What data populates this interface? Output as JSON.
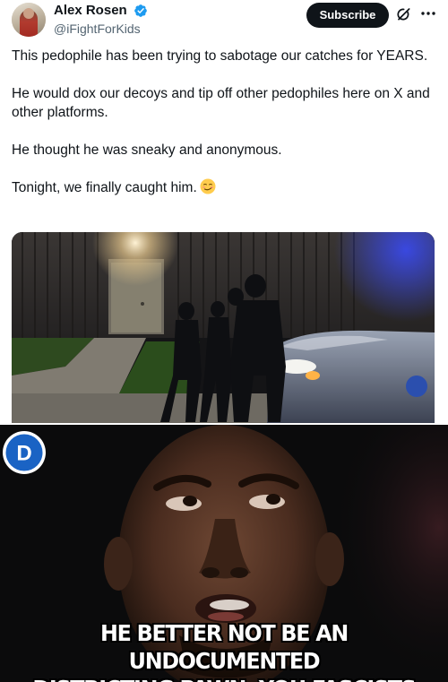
{
  "tweet": {
    "author": {
      "display_name": "Alex Rosen",
      "handle": "@iFightForKids",
      "verified": true
    },
    "subscribe_label": "Subscribe",
    "icons": {
      "verified": "verified-badge-icon",
      "grok": "grok-icon",
      "more": "more-options-icon",
      "emoji": "smirking-face-emoji"
    },
    "paragraphs": [
      "This pedophile has been trying to sabotage our catches for YEARS.",
      "He would dox our decoys and tip off other pedophiles here on X and other platforms.",
      "He thought he was sneaky and anonymous.",
      "Tonight, we finally caught him."
    ],
    "accent_color": "#1d9bf0"
  },
  "meme": {
    "logo": "democratic-party-d-logo",
    "logo_letter": "D",
    "caption_line1": "HE BETTER NOT BE AN UNDOCUMENTED",
    "caption_line2": "DISTRICTING PAWN, YOU FASCISTS"
  }
}
